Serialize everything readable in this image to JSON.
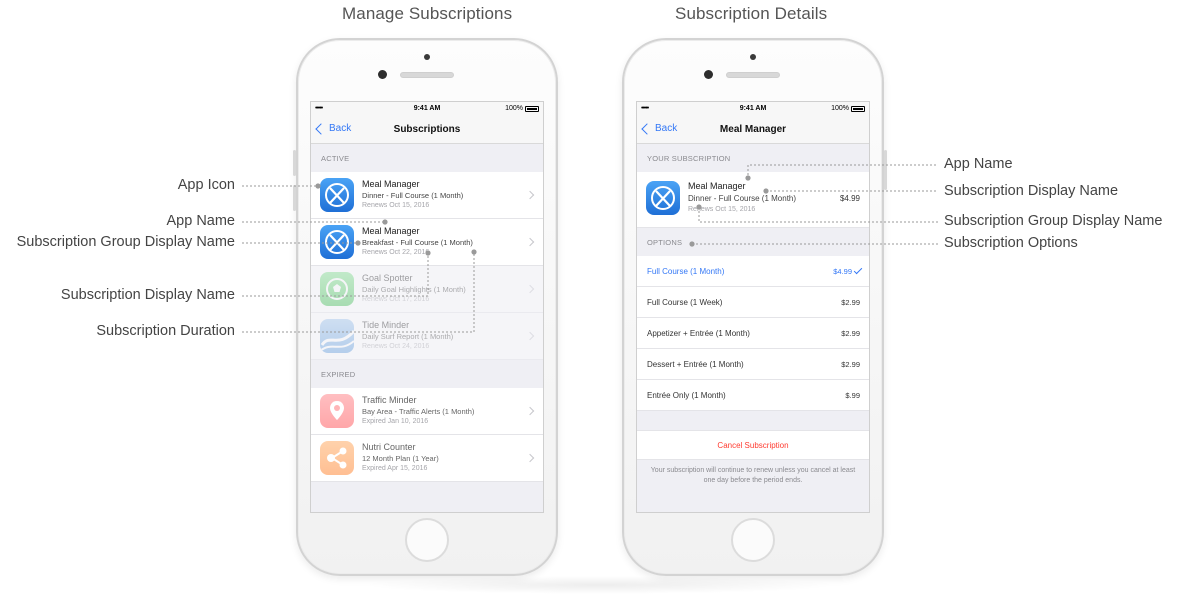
{
  "headings": {
    "left": "Manage Subscriptions",
    "right": "Subscription Details"
  },
  "status": {
    "signal": "•••••",
    "time": "9:41 AM",
    "battery": "100%"
  },
  "left_phone": {
    "nav": {
      "back": "Back",
      "title": "Subscriptions"
    },
    "active_header": "ACTIVE",
    "active": [
      {
        "name": "Meal Manager",
        "plan": "Dinner - Full Course (1 Month)",
        "date": "Renews Oct 15, 2016",
        "icon": "fork-knife-icon"
      },
      {
        "name": "Meal Manager",
        "plan": "Breakfast - Full Course (1 Month)",
        "date": "Renews Oct 22, 2016",
        "icon": "fork-knife-icon"
      },
      {
        "name": "Goal Spotter",
        "plan": "Daily Goal Highlights (1 Month)",
        "date": "Renews Oct 17, 2016",
        "icon": "soccer-ball-icon"
      },
      {
        "name": "Tide Minder",
        "plan": "Daily Surf Report (1 Month)",
        "date": "Renews Oct 24, 2016",
        "icon": "wave-icon"
      }
    ],
    "expired_header": "EXPIRED",
    "expired": [
      {
        "name": "Traffic Minder",
        "plan": "Bay Area - Traffic Alerts (1 Month)",
        "date": "Expired Jan 10, 2016",
        "icon": "map-pin-icon"
      },
      {
        "name": "Nutri Counter",
        "plan": "12 Month Plan (1 Year)",
        "date": "Expired Apr 15, 2016",
        "icon": "share-nodes-icon"
      }
    ]
  },
  "right_phone": {
    "nav": {
      "back": "Back",
      "title": "Meal Manager"
    },
    "your_header": "YOUR SUBSCRIPTION",
    "current": {
      "name": "Meal Manager",
      "plan": "Dinner - Full Course (1 Month)",
      "date": "Renews Oct 15, 2016",
      "price": "$4.99"
    },
    "options_header": "OPTIONS",
    "options": [
      {
        "label": "Full Course (1 Month)",
        "price": "$4.99",
        "selected": true
      },
      {
        "label": "Full Course (1 Week)",
        "price": "$2.99"
      },
      {
        "label": "Appetizer + Entrée (1 Month)",
        "price": "$2.99"
      },
      {
        "label": "Dessert + Entrée (1 Month)",
        "price": "$2.99"
      },
      {
        "label": "Entrée Only (1 Month)",
        "price": "$.99"
      }
    ],
    "cancel": "Cancel Subscription",
    "footnote": "Your subscription will continue to renew unless you cancel at least one day before the period ends."
  },
  "annotations_left": {
    "app_icon": "App Icon",
    "app_name": "App Name",
    "group_name": "Subscription Group Display Name",
    "display_name": "Subscription Display Name",
    "duration": "Subscription Duration"
  },
  "annotations_right": {
    "app_name": "App Name",
    "display_name": "Subscription Display Name",
    "group_name": "Subscription Group Display Name",
    "options": "Subscription Options"
  },
  "colors": {
    "accent": "#3478f6",
    "destructive": "#ff3b30"
  }
}
